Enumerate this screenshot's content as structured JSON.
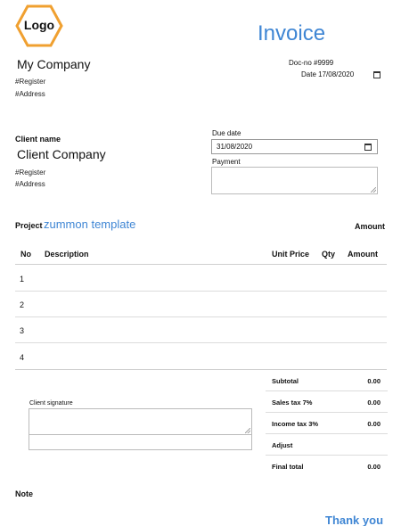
{
  "header": {
    "logo_text": "Logo",
    "title": "Invoice",
    "company_name": "My Company",
    "register": "#Register",
    "address": "#Address",
    "doc_no": "Doc-no #9999",
    "date_label": "Date",
    "date_value": "17/08/2020"
  },
  "client": {
    "label": "Client name",
    "name": "Client Company",
    "register": "#Register",
    "address": "#Address"
  },
  "terms": {
    "due_label": "Due date",
    "due_value": "31/08/2020",
    "payment_label": "Payment",
    "payment_value": ""
  },
  "project": {
    "label": "Project",
    "name": "zummon template",
    "amount_label": "Amount"
  },
  "table": {
    "headers": {
      "no": "No",
      "description": "Description",
      "unit_price": "Unit Price",
      "qty": "Qty",
      "amount": "Amount"
    },
    "rows": [
      "1",
      "2",
      "3",
      "4"
    ]
  },
  "signature": {
    "label": "Client signature"
  },
  "totals": [
    {
      "label": "Subtotal",
      "value": "0.00"
    },
    {
      "label": "Sales tax 7%",
      "value": "0.00"
    },
    {
      "label": "Income tax 3%",
      "value": "0.00"
    },
    {
      "label": "Adjust",
      "value": ""
    },
    {
      "label": "Final total",
      "value": "0.00"
    }
  ],
  "footer": {
    "note_label": "Note",
    "thanks": "Thank you"
  },
  "colors": {
    "accent": "#3f86d4",
    "logo_border": "#f0a030"
  },
  "icons": {
    "date_picker": "calendar-icon",
    "resize": "resize-grip-icon"
  }
}
